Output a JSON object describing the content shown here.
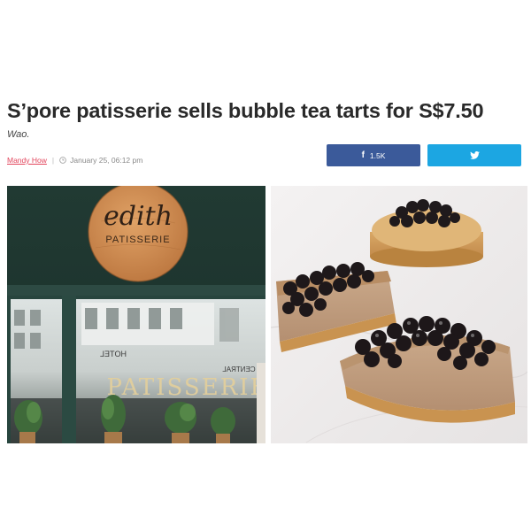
{
  "article": {
    "title": "S’pore patisserie sells bubble tea tarts for S$7.50",
    "subtitle": "Wao.",
    "author": "Mandy How",
    "separator": "|",
    "date": "January 25, 06:12 pm"
  },
  "share": {
    "facebook_count": "1.5K",
    "facebook_icon": "f",
    "facebook_color": "#3b5a9a",
    "twitter_color": "#1ca6e2"
  },
  "photos": {
    "storefront_sign_name": "edith",
    "storefront_sign_sub": "PATISSERIE",
    "window_lettering": "PATISSERIE",
    "reflected_sign_1": "HOTEL",
    "reflected_sign_2": "CENTRAL"
  }
}
